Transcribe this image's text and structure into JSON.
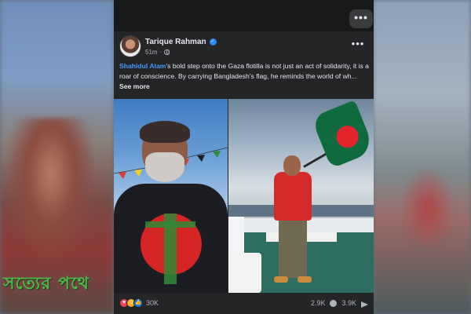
{
  "post": {
    "author": "Tarique Rahman",
    "time": "51m",
    "visibility_icon": "globe-icon",
    "text_mention": "Shahidul Alam",
    "text_body": "’s bold step onto the Gaza flotilla is not just an act of solidarity, it is a roar of conscience. By carrying Bangladesh’s flag, he reminds the world of wh...",
    "see_more": "See more"
  },
  "reactions": {
    "icons": [
      "love-icon",
      "care-icon",
      "like-icon"
    ],
    "count": "30K"
  },
  "stats": {
    "comments": "2.9K",
    "shares": "3.9K"
  },
  "watermark": "সত্যের পথে",
  "colors": {
    "card_bg": "#242526",
    "mention": "#4599ff",
    "verified": "#2d88ff",
    "watermark": "#4eb84a",
    "flag_green": "#0f6a3e",
    "flag_red": "#e3252b"
  }
}
